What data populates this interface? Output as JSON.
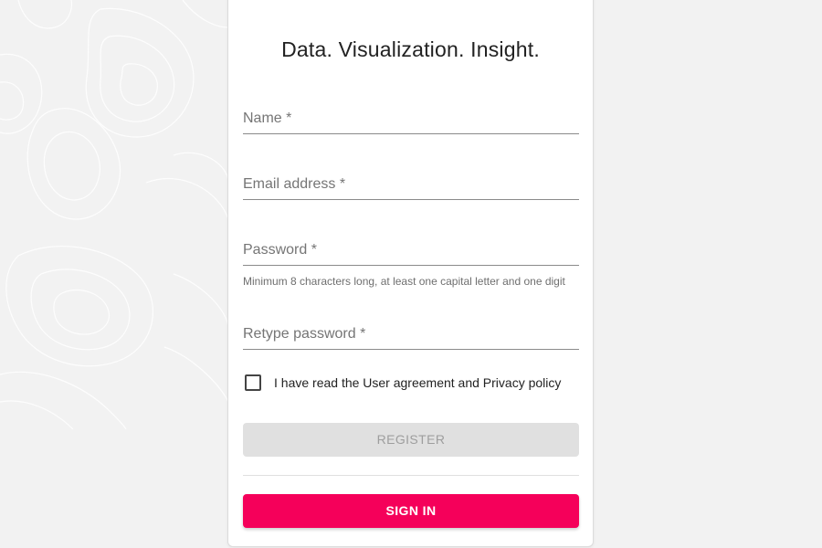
{
  "app": {
    "tagline": "Data. Visualization. Insight."
  },
  "form": {
    "fields": [
      {
        "label": "Name *",
        "value": ""
      },
      {
        "label": "Email address *",
        "value": ""
      },
      {
        "label": "Password *",
        "value": "",
        "helper": "Minimum 8 characters long, at least one capital letter and one digit"
      },
      {
        "label": "Retype password *",
        "value": ""
      }
    ],
    "agreement": {
      "label": "I have read the User agreement and Privacy policy",
      "checked": false
    },
    "register_label": "REGISTER",
    "register_enabled": false,
    "signin_label": "SIGN IN"
  },
  "colors": {
    "accent": "#f5005a",
    "disabled_bg": "#e0e0e0",
    "disabled_text": "#9e9e9e",
    "page_bg": "#f2f2f2"
  }
}
